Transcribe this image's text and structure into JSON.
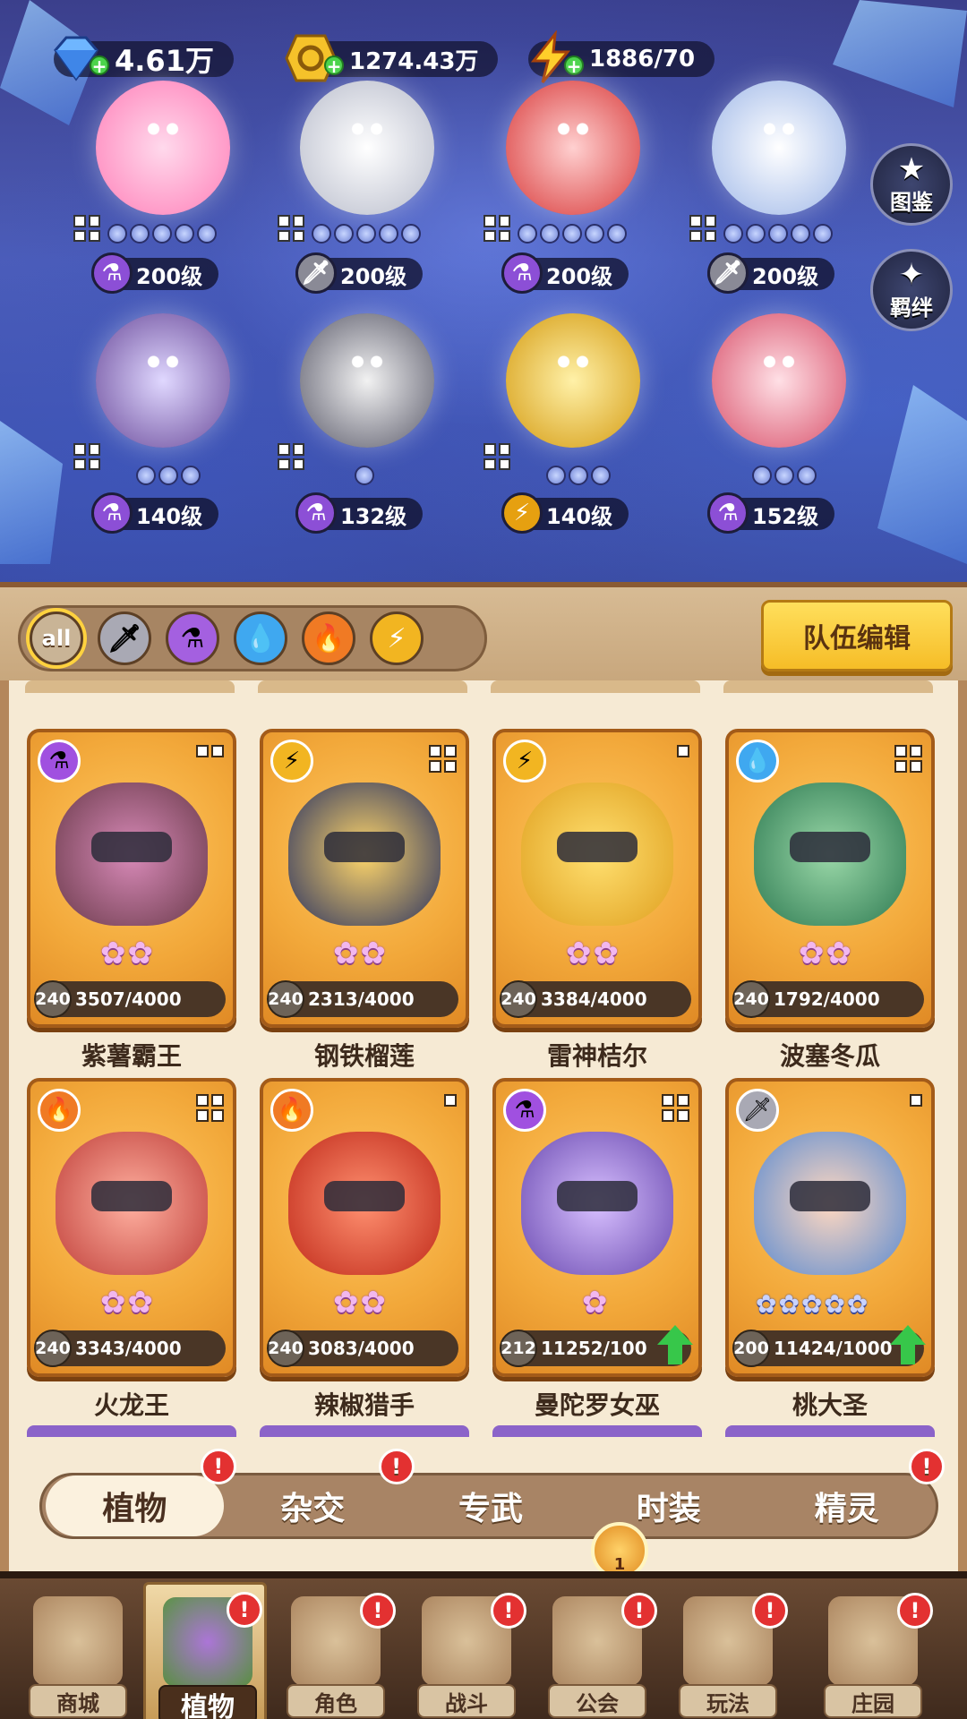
{
  "currencies": [
    {
      "name": "gem",
      "icon": "gem-icon",
      "value": "4.61万",
      "color": "#6fb6ff"
    },
    {
      "name": "gold",
      "icon": "gold-coin-icon",
      "value": "1274.43万",
      "color": "#f5c22a"
    },
    {
      "name": "energy",
      "icon": "lightning-icon",
      "value": "1886/70",
      "color": "#ffcf2a"
    }
  ],
  "side_buttons": [
    {
      "label": "图鉴",
      "icon": "book-icon"
    },
    {
      "label": "羁绊",
      "icon": "bond-icon"
    }
  ],
  "heroes": [
    {
      "level": "200级",
      "element": "magic-potion-icon",
      "dots": 5,
      "grid": true,
      "color": "#ff8fc8"
    },
    {
      "level": "200级",
      "element": "sword-icon",
      "dots": 5,
      "grid": true,
      "color": "#e8e8f0"
    },
    {
      "level": "200级",
      "element": "magic-potion-icon",
      "dots": 5,
      "grid": true,
      "color": "#e85a5a"
    },
    {
      "level": "200级",
      "element": "sword-icon",
      "dots": 5,
      "grid": true,
      "color": "#f2f2fa"
    },
    {
      "level": "140级",
      "element": "magic-potion-icon",
      "dots": 3,
      "grid": true,
      "color": "#9a7acb"
    },
    {
      "level": "132级",
      "element": "magic-potion-icon",
      "dots": 1,
      "grid": true,
      "color": "#b8b8c8"
    },
    {
      "level": "140级",
      "element": "lightning-icon",
      "dots": 3,
      "grid": true,
      "color": "#f2c230"
    },
    {
      "level": "152级",
      "element": "magic-potion-icon",
      "dots": 3,
      "grid": false,
      "color": "#f07a9a"
    }
  ],
  "filters": [
    {
      "label": "all",
      "icon": "all-filter-icon",
      "active": true
    },
    {
      "label": "",
      "icon": "sword-icon",
      "active": false
    },
    {
      "label": "",
      "icon": "magic-potion-icon",
      "active": false
    },
    {
      "label": "",
      "icon": "water-drop-icon",
      "active": false
    },
    {
      "label": "",
      "icon": "fire-icon",
      "active": false
    },
    {
      "label": "",
      "icon": "lightning-icon",
      "active": false
    }
  ],
  "team_edit_label": "队伍编辑",
  "cards": [
    {
      "name": "紫薯霸王",
      "level": "240",
      "progress": "3507/4000",
      "element": "magic-potion-icon",
      "grid": 4,
      "stars": 2,
      "star_type": "pink",
      "upgrade": false,
      "color": "#a8638f"
    },
    {
      "name": "钢铁榴莲",
      "level": "240",
      "progress": "2313/4000",
      "element": "lightning-icon",
      "grid": 4,
      "stars": 2,
      "star_type": "pink",
      "upgrade": false,
      "color": "#e9b23a"
    },
    {
      "name": "雷神桔尔",
      "level": "240",
      "progress": "3384/4000",
      "element": "lightning-icon",
      "grid": 1,
      "stars": 2,
      "star_type": "pink",
      "upgrade": false,
      "color": "#f2c13a"
    },
    {
      "name": "波塞冬瓜",
      "level": "240",
      "progress": "1792/4000",
      "element": "water-drop-icon",
      "grid": 4,
      "stars": 2,
      "star_type": "pink",
      "upgrade": false,
      "color": "#4ea86a"
    },
    {
      "name": "火龙王",
      "level": "240",
      "progress": "3343/4000",
      "element": "fire-icon",
      "grid": 4,
      "stars": 2,
      "star_type": "pink",
      "upgrade": false,
      "color": "#d4584a"
    },
    {
      "name": "辣椒猎手",
      "level": "240",
      "progress": "3083/4000",
      "element": "fire-icon",
      "grid": 2,
      "stars": 2,
      "star_type": "pink",
      "upgrade": false,
      "color": "#e0482e"
    },
    {
      "name": "曼陀罗女巫",
      "level": "212",
      "progress": "11252/100",
      "element": "magic-potion-icon",
      "grid": 4,
      "stars": 1,
      "star_type": "pink",
      "upgrade": true,
      "color": "#8a6ad0"
    },
    {
      "name": "桃大圣",
      "level": "200",
      "progress": "11424/1000",
      "element": "sword-icon",
      "grid": 1,
      "stars": 5,
      "star_type": "blue",
      "upgrade": true,
      "color": "#e8a890"
    }
  ],
  "subtabs": [
    {
      "label": "植物",
      "active": true,
      "alert": true
    },
    {
      "label": "杂交",
      "active": false,
      "alert": true
    },
    {
      "label": "专武",
      "active": false,
      "alert": false
    },
    {
      "label": "时装",
      "active": false,
      "alert": false
    },
    {
      "label": "精灵",
      "active": false,
      "alert": true
    }
  ],
  "nav": [
    {
      "label": "商城",
      "icon": "shop-icon",
      "active": false,
      "alert": false
    },
    {
      "label": "植物",
      "icon": "plants-icon",
      "active": true,
      "alert": true
    },
    {
      "label": "角色",
      "icon": "character-icon",
      "active": false,
      "alert": true
    },
    {
      "label": "战斗",
      "icon": "battle-icon",
      "active": false,
      "alert": true
    },
    {
      "label": "公会",
      "icon": "guild-icon",
      "active": false,
      "alert": true
    },
    {
      "label": "玩法",
      "icon": "gameplay-icon",
      "active": false,
      "alert": true
    },
    {
      "label": "庄园",
      "icon": "manor-icon",
      "active": false,
      "alert": true
    }
  ],
  "guild_badge": "1",
  "alert_glyph": "!"
}
